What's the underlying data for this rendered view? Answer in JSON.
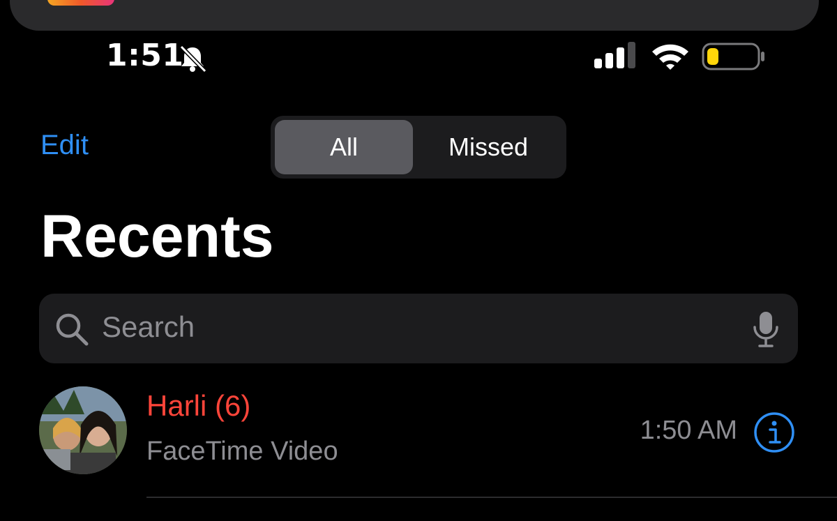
{
  "status_bar": {
    "time": "1:51",
    "silent_icon": "bell-slash-icon",
    "signal_icon": "cellular-signal-icon",
    "wifi_icon": "wifi-icon",
    "battery_icon": "battery-low-power-icon",
    "battery_level": 0.2,
    "battery_color": "#ffd60a"
  },
  "nav": {
    "edit_label": "Edit",
    "segments": [
      "All",
      "Missed"
    ],
    "selected_segment": "All"
  },
  "page": {
    "title": "Recents"
  },
  "search": {
    "placeholder": "Search",
    "search_icon": "magnifying-glass-icon",
    "mic_icon": "microphone-icon"
  },
  "recents": [
    {
      "name": "Harli (6)",
      "type": "FaceTime Video",
      "time": "1:50 AM",
      "missed": true,
      "info_icon": "info-circle-icon"
    }
  ],
  "colors": {
    "accent": "#2f8ff5",
    "missed": "#ff453a",
    "secondary_text": "#8e8e93",
    "background": "#000000"
  }
}
